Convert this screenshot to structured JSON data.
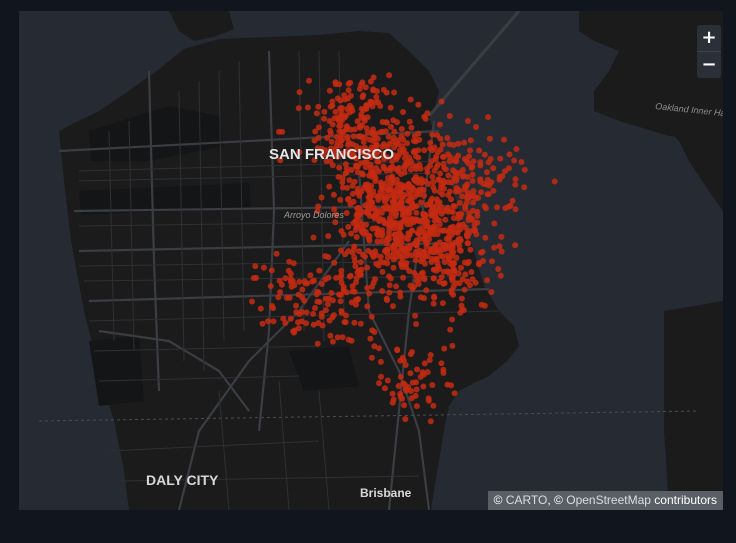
{
  "map": {
    "basemap_style": "dark",
    "colors": {
      "page_background": "#11161e",
      "water": "#262b33",
      "land": "#1b1b1c",
      "park": "#141516",
      "major_road": "#3a3d42",
      "minor_road": "#2e3033",
      "point": "#c42a12",
      "label": "#d9d9d9",
      "minor_label": "#9a9a9a"
    },
    "labels": {
      "city_main": "SAN FRANCISCO",
      "city_south": "DALY CITY",
      "city_brisbane": "Brisbane",
      "neighborhood": "Arroyo Dolores",
      "inner_harbor": "Oakland Inner Har"
    },
    "point_layer": {
      "color": "#c42a12",
      "marker": "circle",
      "distribution_note": ""
    }
  },
  "controls": {
    "zoom_in_icon": "+",
    "zoom_out_icon": "−"
  },
  "attribution": {
    "copyright_symbol_1": "©",
    "carto": "CARTO",
    "separator": ", ",
    "copyright_symbol_2": "©",
    "osm": "OpenStreetMap",
    "contributors": "contributors"
  }
}
